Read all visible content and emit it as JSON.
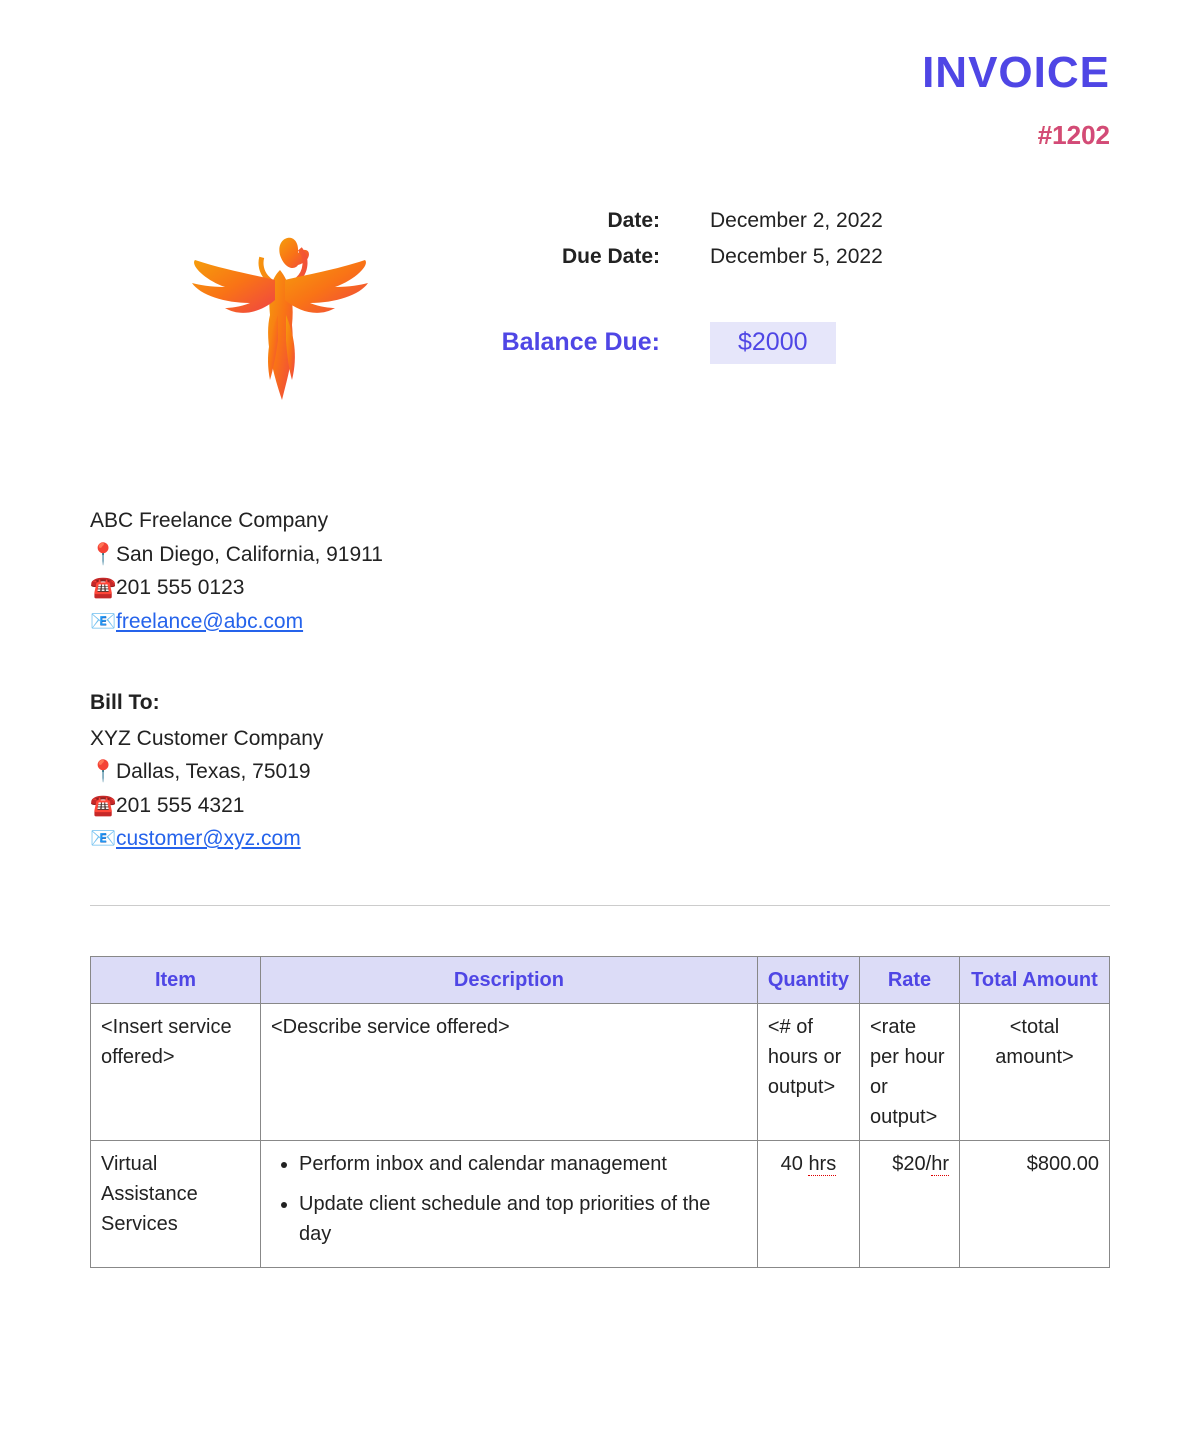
{
  "header": {
    "title": "INVOICE",
    "number": "#1202"
  },
  "dates": {
    "date_label": "Date:",
    "date_value": "December 2, 2022",
    "due_label": "Due Date:",
    "due_value": "December 5, 2022"
  },
  "balance": {
    "label": "Balance Due:",
    "value": "$2000"
  },
  "from": {
    "company": "ABC Freelance Company",
    "address": "San Diego, California, 91911",
    "phone": "201 555 0123",
    "email": "freelance@abc.com"
  },
  "bill_to": {
    "heading": "Bill To:",
    "company": "XYZ Customer Company",
    "address": "Dallas, Texas, 75019",
    "phone": "201 555 4321",
    "email": "customer@xyz.com"
  },
  "table": {
    "headers": {
      "item": "Item",
      "description": "Description",
      "quantity": "Quantity",
      "rate": "Rate",
      "total": "Total Amount"
    },
    "row1": {
      "item": "<Insert service offered>",
      "description": "<Describe service offered>",
      "quantity": "<# of hours or output>",
      "rate": "<rate per hour or output>",
      "total": "<total amount>"
    },
    "row2": {
      "item": "Virtual Assistance Services",
      "desc1": "Perform inbox and calendar management",
      "desc2": "Update client schedule and top priorities of the day",
      "qty_num": "40 ",
      "qty_unit": "hrs",
      "rate_num": "$20/",
      "rate_unit": "hr",
      "total": "$800.00"
    }
  }
}
